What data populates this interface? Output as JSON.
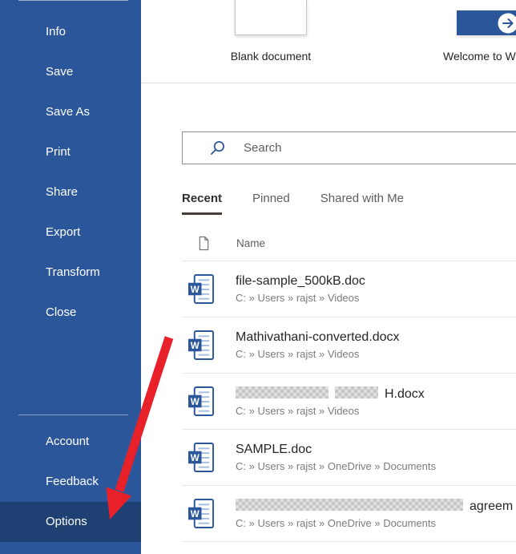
{
  "sidebar": {
    "items": [
      {
        "label": "Info"
      },
      {
        "label": "Save"
      },
      {
        "label": "Save As"
      },
      {
        "label": "Print"
      },
      {
        "label": "Share"
      },
      {
        "label": "Export"
      },
      {
        "label": "Transform"
      },
      {
        "label": "Close"
      }
    ],
    "bottom_items": [
      {
        "label": "Account",
        "selected": false
      },
      {
        "label": "Feedback",
        "selected": false
      },
      {
        "label": "Options",
        "selected": true
      }
    ]
  },
  "templates": [
    {
      "label": "Blank document"
    },
    {
      "label": "Welcome to W"
    }
  ],
  "search": {
    "placeholder": "Search"
  },
  "tabs": [
    {
      "label": "Recent",
      "active": true
    },
    {
      "label": "Pinned",
      "active": false
    },
    {
      "label": "Shared with Me",
      "active": false
    }
  ],
  "file_list": {
    "header": {
      "name_label": "Name"
    },
    "rows": [
      {
        "name": "file-sample_500kB.doc",
        "path": "C: » Users » rajst » Videos",
        "redacted": false
      },
      {
        "name": "Mathivathani-converted.docx",
        "path": "C: » Users » rajst » Videos",
        "redacted": false
      },
      {
        "name": "H.docx",
        "path": "C: » Users » rajst » Videos",
        "redacted": true,
        "redaction_widths": [
          116,
          54
        ],
        "redaction_note": "file name prefix pixelated"
      },
      {
        "name": "SAMPLE.doc",
        "path": "C: » Users » rajst » OneDrive » Documents",
        "redacted": false
      },
      {
        "name": "agreem",
        "path": "C: » Users » rajst » OneDrive » Documents",
        "redacted": true,
        "redaction_widths": [
          284
        ],
        "redaction_note": "file name prefix pixelated, name clipped at right edge"
      }
    ]
  },
  "annotation": {
    "type": "red-arrow",
    "points_to": "Options"
  },
  "colors": {
    "sidebar_blue": "#2b579a",
    "sidebar_selected": "#1e4073",
    "accent_blue": "#2b579a",
    "tab_underline": "#473d38",
    "arrow_red": "#e8202a"
  }
}
